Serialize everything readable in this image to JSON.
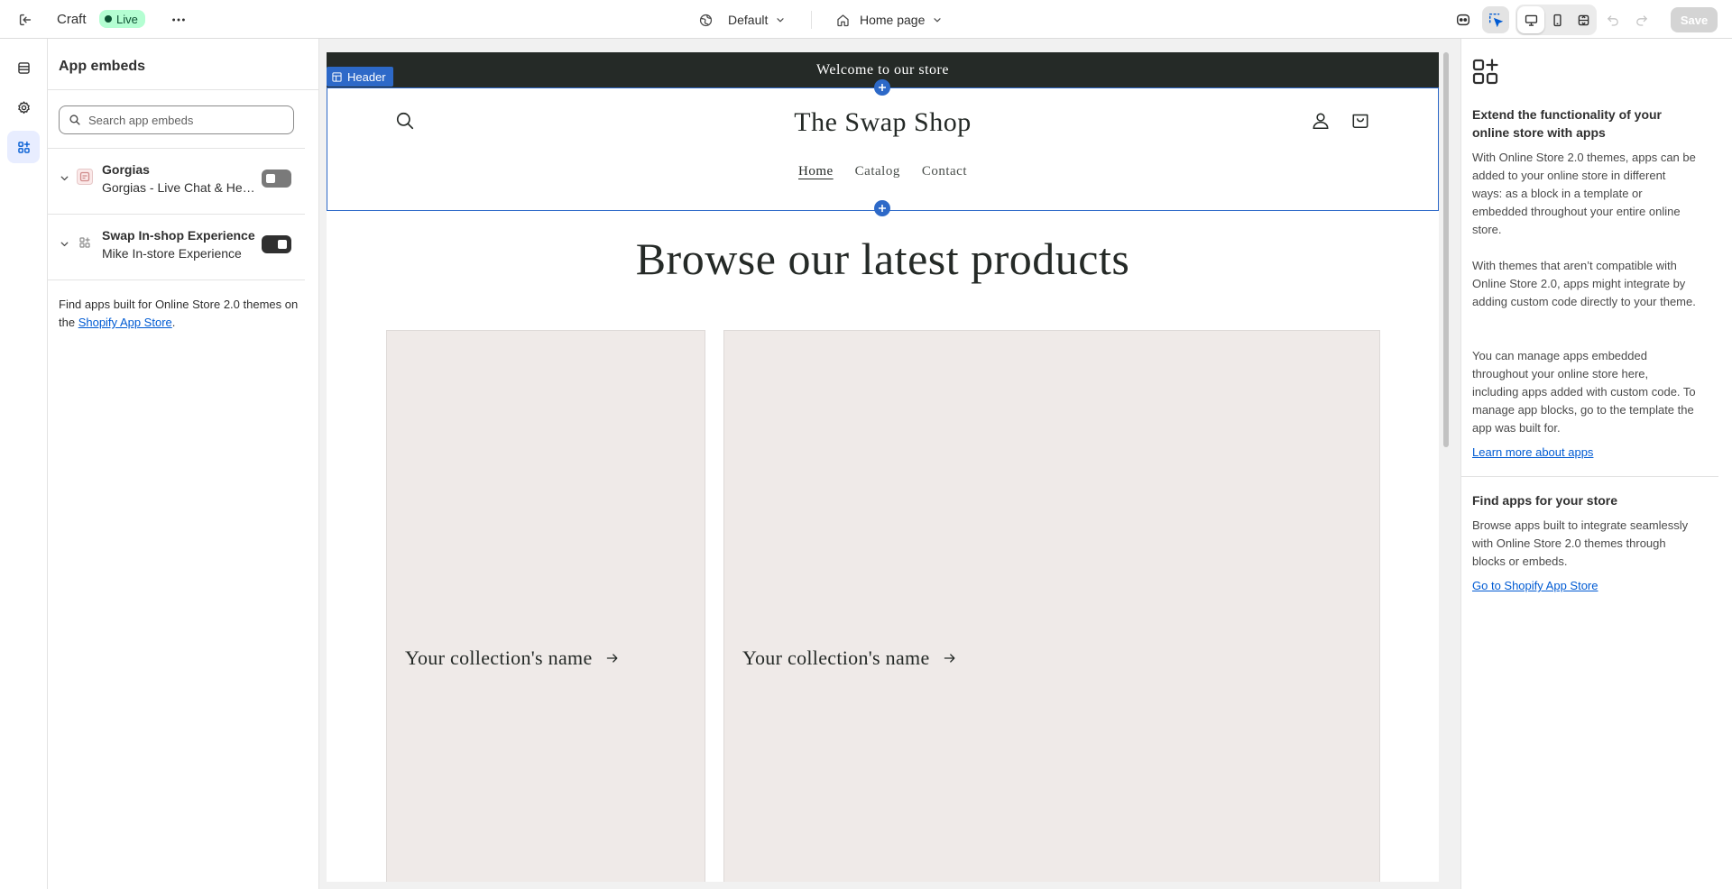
{
  "topbar": {
    "theme_name": "Craft",
    "status": "Live",
    "template": "Default",
    "page": "Home page",
    "save_label": "Save"
  },
  "sidebar": {
    "title": "App embeds",
    "search": {
      "placeholder": "Search app embeds",
      "value": ""
    },
    "apps": [
      {
        "name": "Gorgias",
        "subtitle": "Gorgias - Live Chat & Help Desk",
        "enabled": false,
        "icon": "gorgias-app-icon"
      },
      {
        "name": "Swap In-shop Experience",
        "subtitle": "Mike In-store Experience",
        "enabled": true,
        "icon": "app-grid-icon"
      }
    ],
    "footer_text": "Find apps built for Online Store 2.0 themes on the ",
    "footer_link": "Shopify App Store",
    "footer_end": "."
  },
  "preview": {
    "announcement": "Welcome to our store",
    "section_tag": "Header",
    "store_name": "The Swap Shop",
    "nav": [
      "Home",
      "Catalog",
      "Contact"
    ],
    "current_nav": "Home",
    "heading": "Browse our latest products",
    "collections": [
      {
        "label": "Your collection's name"
      },
      {
        "label": "Your collection's name"
      }
    ]
  },
  "right_panel": {
    "heading": "Extend the functionality of your online store with apps",
    "p1": "With Online Store 2.0 themes, apps can be added to your online store in different ways: as a block in a template or embedded throughout your entire online store.",
    "p2": "With themes that aren’t compatible with Online Store 2.0, apps might integrate by adding custom code directly to your theme.",
    "p3": "You can manage apps embedded throughout your online store here, including apps added with custom code. To manage app blocks, go to the template the app was built for.",
    "learn_link": "Learn more about apps",
    "find_heading": "Find apps for your store",
    "find_text": "Browse apps built to integrate seamlessly with Online Store 2.0 themes through blocks or embeds.",
    "store_link": "Go to Shopify App Store"
  },
  "colors": {
    "accent": "#2d69c8",
    "live_badge": "#b4fed2",
    "announcement_bg": "#252a27",
    "card_bg": "#efeae8",
    "link": "#005bd3"
  }
}
